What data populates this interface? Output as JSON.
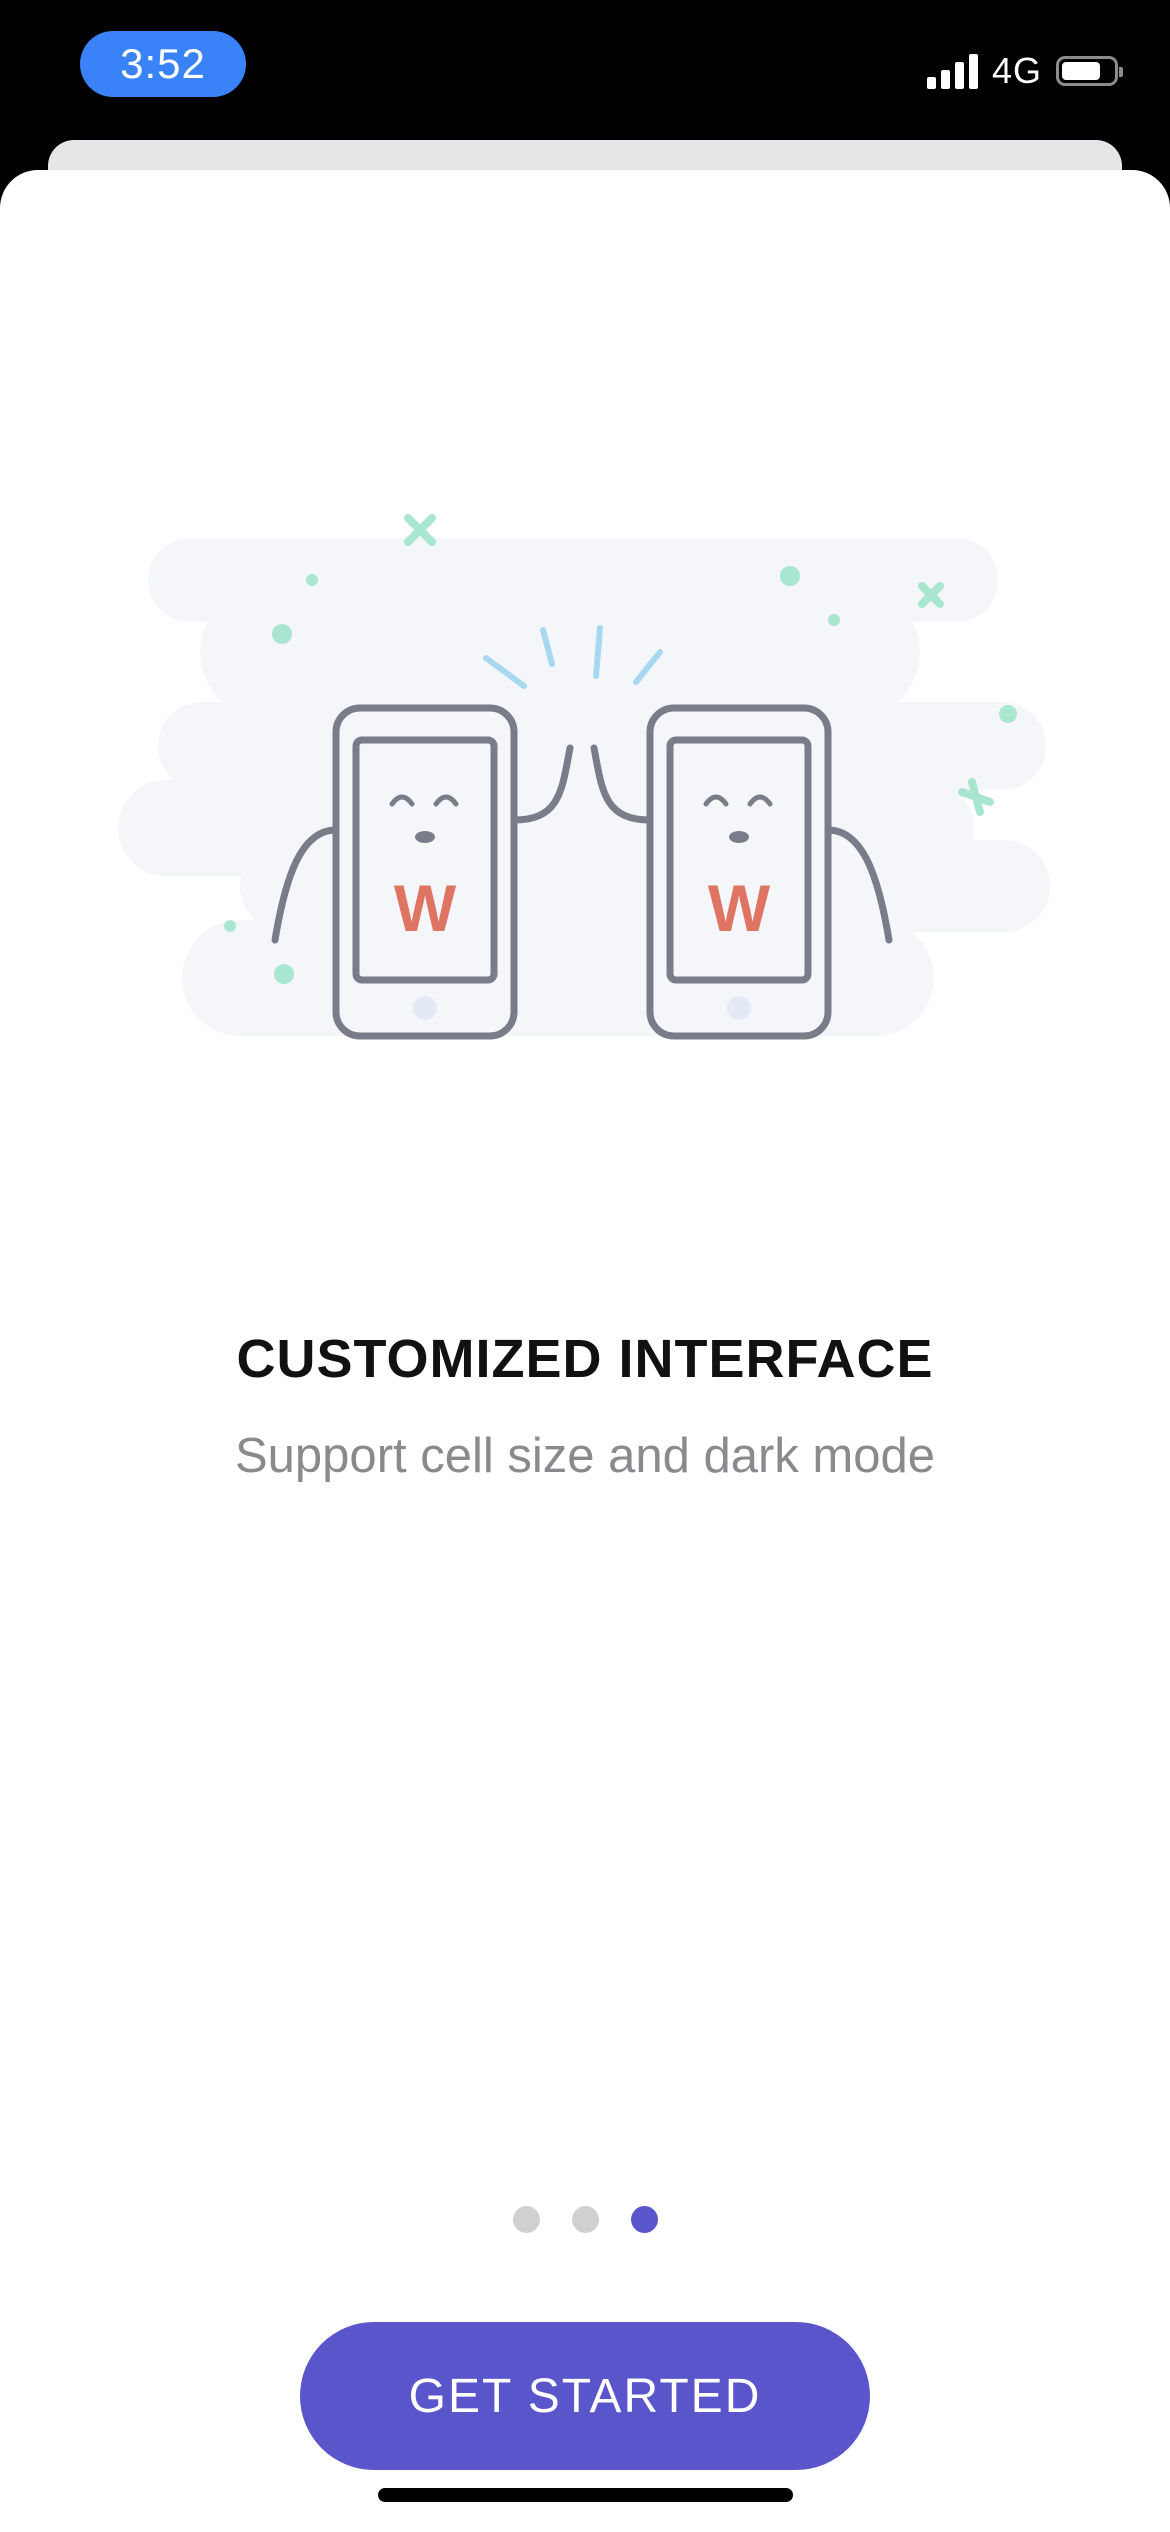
{
  "status_bar": {
    "time": "3:52",
    "network": "4G",
    "battery_level": 0.75,
    "signal_bars": 4
  },
  "onboarding": {
    "title": "CUSTOMIZED INTERFACE",
    "subtitle": "Support cell size and dark mode",
    "page_count": 3,
    "active_page": 3,
    "illustration_letter": "W"
  },
  "cta": {
    "label": "GET STARTED"
  },
  "colors": {
    "accent": "#5a55cb",
    "time_pill": "#3a82f7",
    "logo": "#e07462",
    "sparkle_green": "#a8e6cf",
    "sparkle_blue": "#a8d8f0",
    "outline": "#7a7c8a"
  }
}
